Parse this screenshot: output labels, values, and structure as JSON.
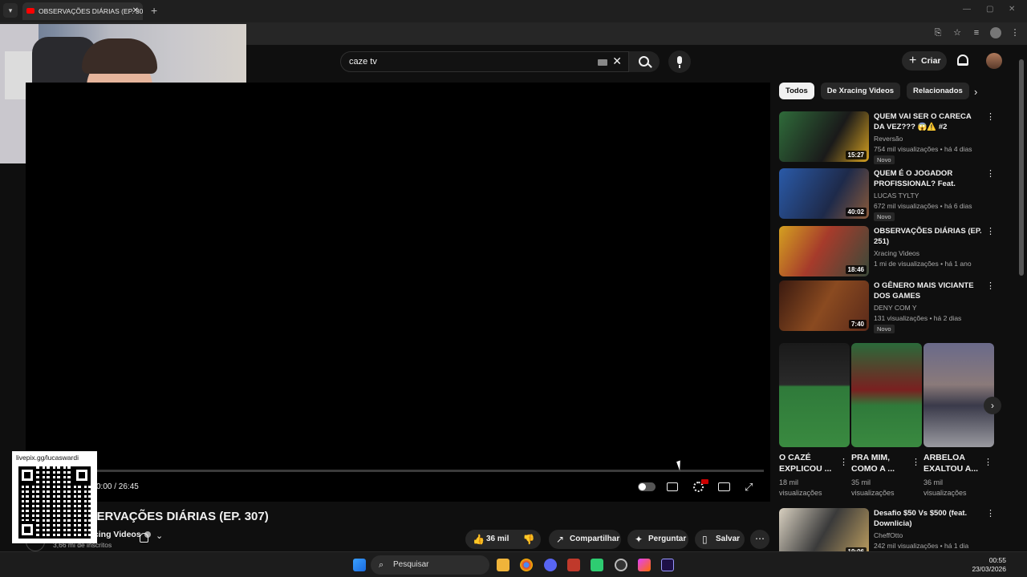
{
  "browser": {
    "tab_title": "OBSERVAÇÕES DIÁRIAS (EP. 307)",
    "tab_close": "✕",
    "new_tab": "+"
  },
  "search": {
    "query": "caze tv",
    "clear_glyph": "✕"
  },
  "header": {
    "create_label": "Criar",
    "create_glyph": "+"
  },
  "player": {
    "time": "0:00 / 26:45",
    "progress": 0.0
  },
  "video": {
    "title": "OBSERVAÇÕES DIÁRIAS (EP. 307)",
    "channel": "Xracing Videos",
    "subscribers": "3,66 mi de inscritos",
    "likes": "36 mil",
    "share_label": "Compartilhar",
    "ask_label": "Perguntar",
    "save_label": "Salvar"
  },
  "qr": {
    "label": "livepix.gg/lucaswardi"
  },
  "sidebar": {
    "chips": [
      "Todos",
      "De Xracing Videos",
      "Relacionados"
    ],
    "recommendations": [
      {
        "title": "QUEM VAI SER O CARECA DA VEZ??? 😱⚠️ #2",
        "channel": "Reversão",
        "meta": "754 mil visualizações • há 4 dias",
        "badge": "Novo",
        "duration": "15:27",
        "thumb_color": "#2f6b3a"
      },
      {
        "title": "QUEM É O JOGADOR PROFISSIONAL? Feat. Fernan...",
        "channel": "LUCAS TYLTY",
        "meta": "672 mil visualizações • há 6 dias",
        "badge": "Novo",
        "duration": "40:02",
        "thumb_color": "#2a5aa8"
      },
      {
        "title": "OBSERVAÇÕES DIÁRIAS (EP. 251)",
        "channel": "Xracing Videos",
        "meta": "1 mi de visualizações • há 1 ano",
        "badge": "",
        "duration": "18:46",
        "thumb_color": "#a63b2b"
      },
      {
        "title": "O GÊNERO MAIS VICIANTE DOS GAMES",
        "channel": "DENY COM Y",
        "meta": "131 visualizações • há 2 dias",
        "badge": "Novo",
        "duration": "7:40",
        "thumb_color": "#5a2a1a"
      }
    ],
    "shorts": [
      {
        "title": "O CAZÉ EXPLICOU ...",
        "views": "18 mil visualizações",
        "thumb_color": "#2f7a3a"
      },
      {
        "title": "PRA MIM, COMO A ...",
        "views": "35 mil visualizações",
        "thumb_color": "#7a2020"
      },
      {
        "title": "ARBELOA EXALTOU A...",
        "views": "36 mil visualizações",
        "thumb_color": "#6a6a8a"
      }
    ],
    "last": {
      "title": "Desafio $50 Vs $500 (feat. Downlicia)",
      "channel": "CheffOtto",
      "meta": "242 mil visualizações • há 1 dia",
      "duration": "19:06",
      "thumb_color": "#3a3a3a"
    }
  },
  "taskbar": {
    "search_label": "Pesquisar",
    "time": "00:55",
    "date": "23/03/2026"
  }
}
